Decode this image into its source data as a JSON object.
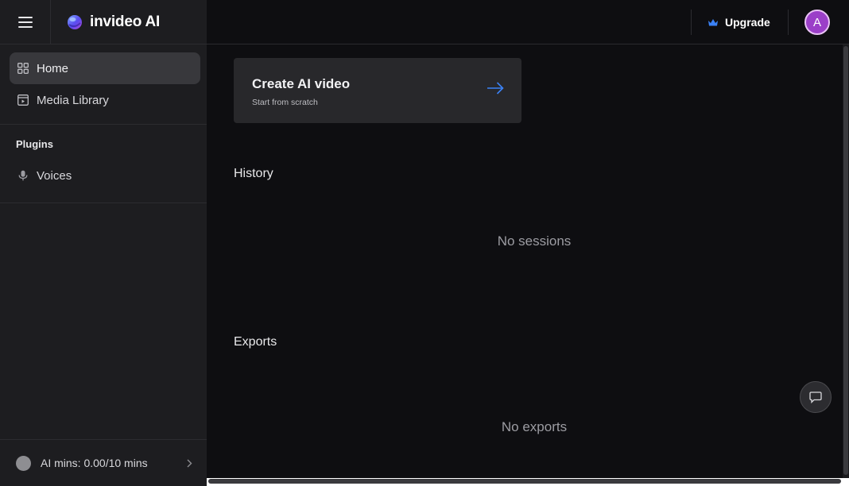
{
  "app": {
    "name": "invideo AI"
  },
  "sidebar": {
    "nav": [
      {
        "label": "Home",
        "icon": "grid-icon",
        "active": true
      },
      {
        "label": "Media Library",
        "icon": "media-library-icon",
        "active": false
      }
    ],
    "plugins_title": "Plugins",
    "plugins": [
      {
        "label": "Voices",
        "icon": "microphone-icon"
      }
    ],
    "footer": {
      "label": "AI mins: 0.00/10 mins"
    }
  },
  "topbar": {
    "upgrade_label": "Upgrade",
    "avatar_initial": "A"
  },
  "main": {
    "create_card": {
      "title": "Create AI video",
      "subtitle": "Start from scratch"
    },
    "history": {
      "title": "History",
      "empty": "No sessions"
    },
    "exports": {
      "title": "Exports",
      "empty": "No exports"
    }
  },
  "colors": {
    "accent": "#3b82f6",
    "avatar_bg": "#9b3fc8",
    "sidebar_bg": "#1d1d20",
    "main_bg": "#0e0e11",
    "card_bg": "#28282b"
  }
}
